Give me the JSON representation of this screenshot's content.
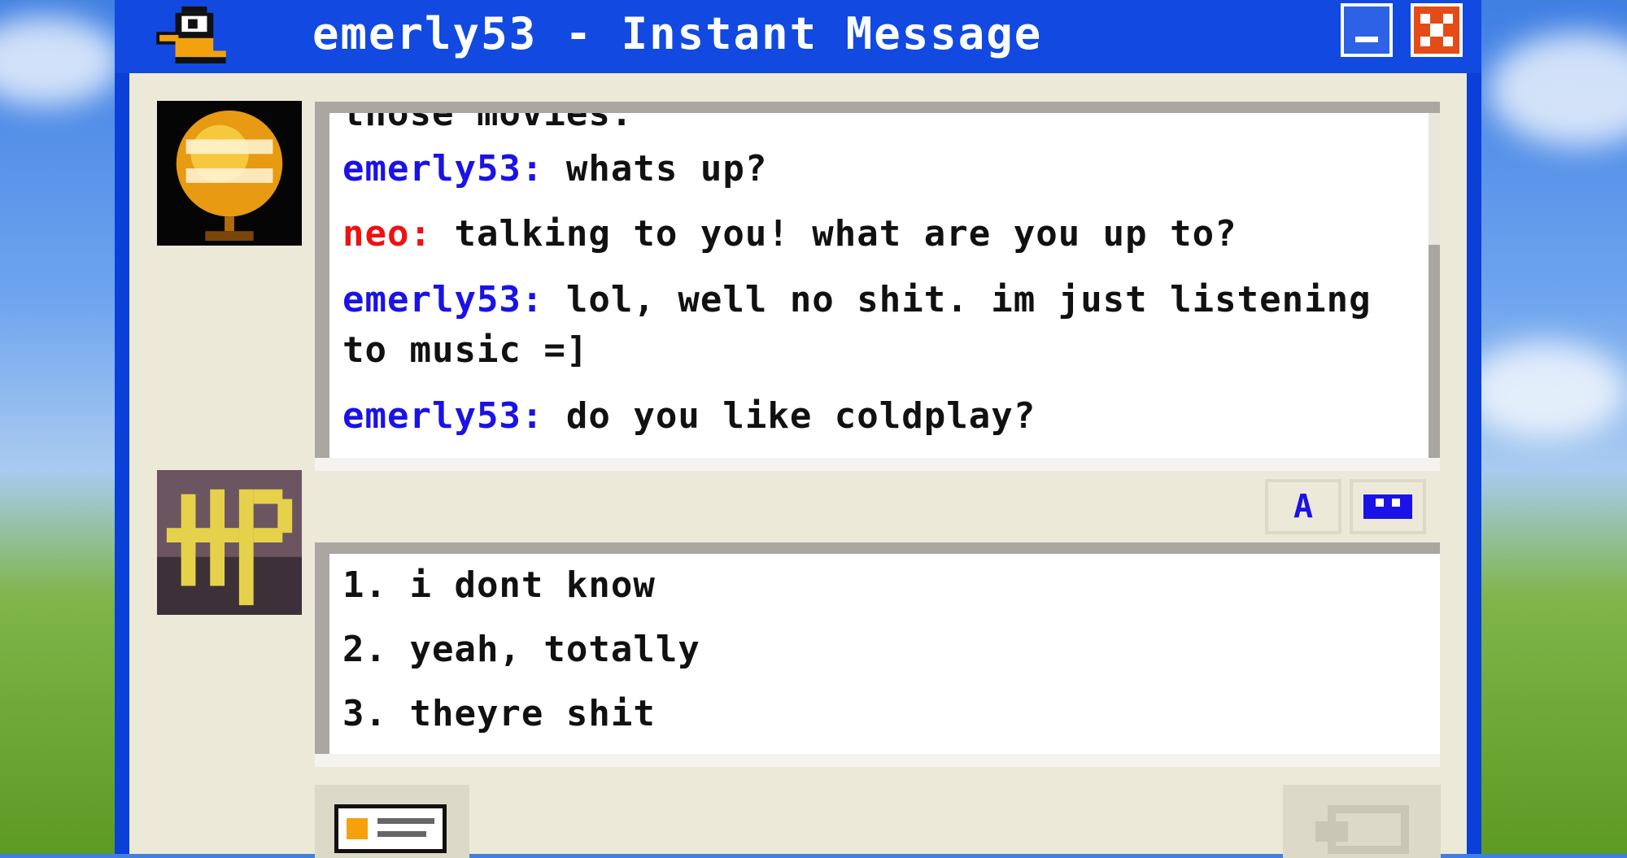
{
  "window": {
    "title": "emerly53 - Instant Message"
  },
  "titlebar": {
    "icon": "aim-buddy-icon",
    "minimize": "minimize-icon",
    "close": "close-icon"
  },
  "conversation": {
    "partial_top_line": "those movies.",
    "messages": [
      {
        "sender": "emerly53:",
        "text": " whats up?",
        "color": "#1a12e6"
      },
      {
        "sender": "neo:",
        "text": " talking to you! what are you up to?",
        "color": "#f01010"
      },
      {
        "sender": "emerly53:",
        "text": " lol, well no shit. im just listening to music =]",
        "color": "#1a12e6"
      },
      {
        "sender": "emerly53:",
        "text": " do you like coldplay?",
        "color": "#1a12e6"
      }
    ]
  },
  "avatars": {
    "buddy": "coldplay-globe-avatar",
    "self": "harry-potter-hp-avatar"
  },
  "format_buttons": {
    "font_label": "A",
    "other": "face-icon"
  },
  "reply_options": [
    "1. i dont know",
    "2. yeah, totally",
    "3. theyre shit"
  ],
  "footer": {
    "left_icon": "buddy-info-icon",
    "right_icon": "send-icon"
  }
}
